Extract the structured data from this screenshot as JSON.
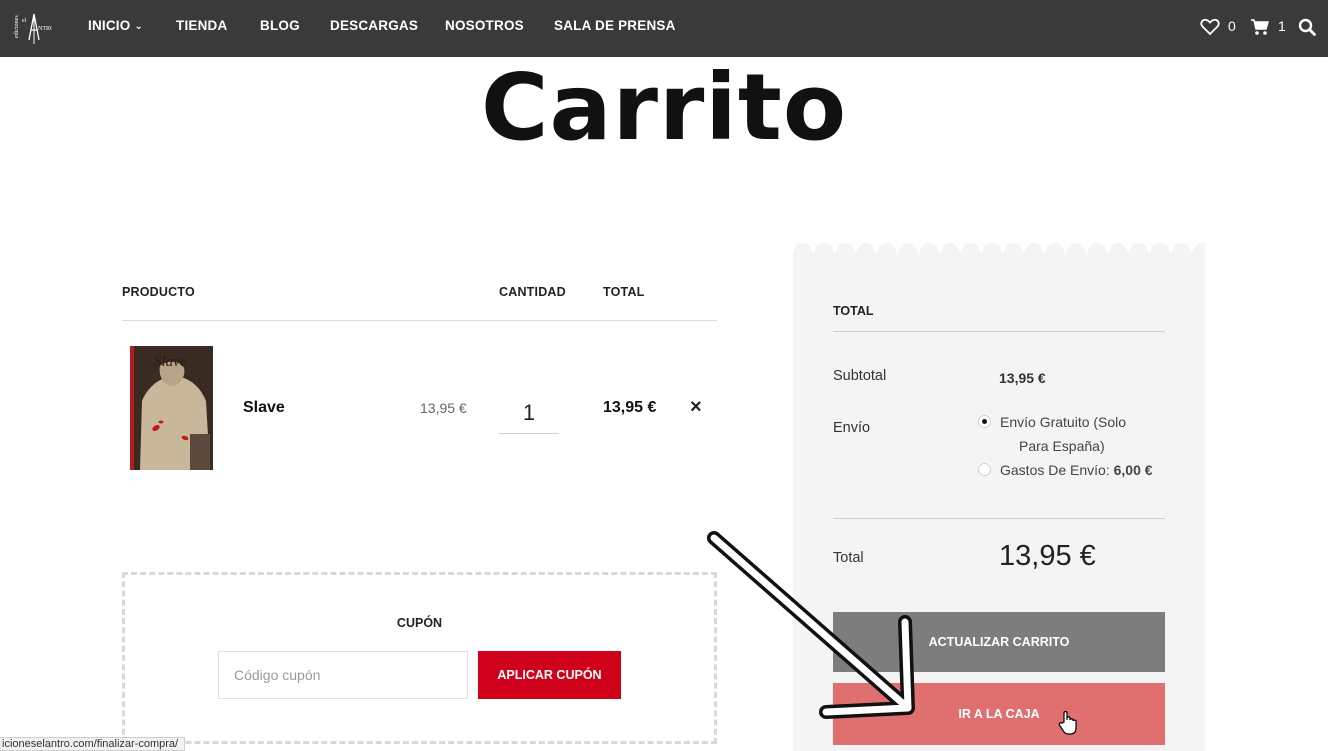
{
  "nav": {
    "items": [
      {
        "label": "INICIO",
        "has_dropdown": true
      },
      {
        "label": "TIENDA"
      },
      {
        "label": "BLOG"
      },
      {
        "label": "DESCARGAS"
      },
      {
        "label": "NOSOTROS"
      },
      {
        "label": "SALA DE PRENSA"
      }
    ],
    "wishlist_count": "0",
    "cart_count": "1",
    "icons": [
      "heart-icon",
      "cart-icon",
      "search-icon"
    ]
  },
  "page": {
    "title": "Carrito"
  },
  "cart": {
    "headers": {
      "product": "PRODUCTO",
      "quantity": "CANTIDAD",
      "total": "TOTAL"
    },
    "items": [
      {
        "name": "Slave",
        "price": "13,95 €",
        "quantity": "1",
        "total": "13,95 €",
        "remove_icon": "×"
      }
    ]
  },
  "coupon": {
    "title": "CUPÓN",
    "placeholder": "Código cupón",
    "apply_label": "APLICAR CUPÓN"
  },
  "totals": {
    "title": "TOTAL",
    "subtotal_label": "Subtotal",
    "subtotal_value": "13,95 €",
    "shipping_label": "Envío",
    "shipping_options": [
      {
        "line1": "Envío Gratuito (Solo",
        "line2": "Para España)",
        "checked": true
      },
      {
        "label": "Gastos De Envío:",
        "price": "6,00 €",
        "checked": false
      }
    ],
    "total_label": "Total",
    "total_value": "13,95 €",
    "update_label": "ACTUALIZAR CARRITO",
    "checkout_label": "IR A LA CAJA"
  },
  "status_bar": {
    "url": "icioneselantro.com/finalizar-compra/"
  },
  "colors": {
    "topbar": "#3a3a3a",
    "coupon_button": "#d0021b",
    "update_button": "#7d7d7d",
    "checkout_button": "#e07070",
    "panel": "#f4f4f4"
  }
}
